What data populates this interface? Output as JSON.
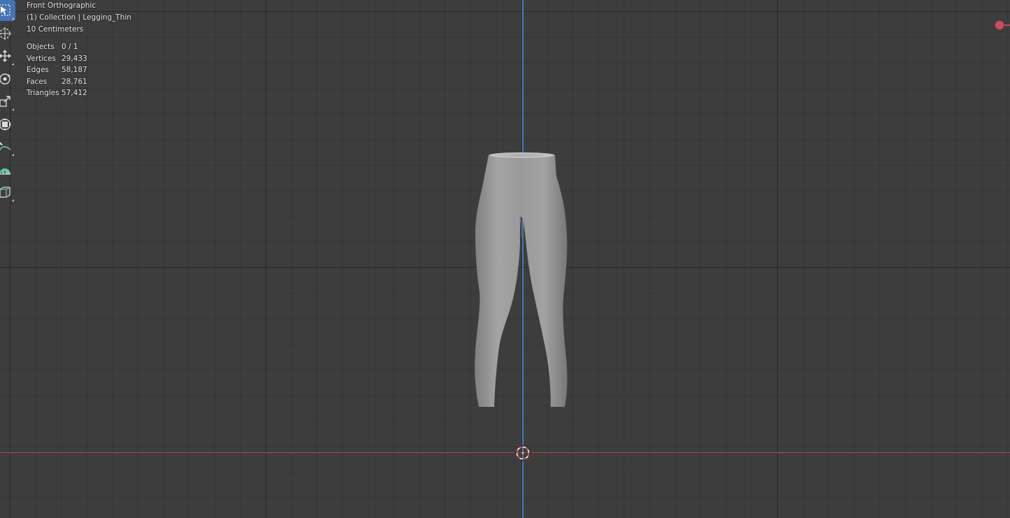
{
  "viewport": {
    "view_name": "Front Orthographic",
    "collection_line": "(1) Collection | Legging_Thin",
    "grid_scale": "10 Centimeters"
  },
  "stats": [
    {
      "label": "Objects",
      "value": "0 / 1"
    },
    {
      "label": "Vertices",
      "value": "29,433"
    },
    {
      "label": "Edges",
      "value": "58,187"
    },
    {
      "label": "Faces",
      "value": "28,761"
    },
    {
      "label": "Triangles",
      "value": "57,412"
    }
  ],
  "toolbar": [
    {
      "name": "select-box",
      "icon": "select-box-icon",
      "active": true
    },
    {
      "name": "cursor",
      "icon": "cursor-icon"
    },
    {
      "name": "move",
      "icon": "move-icon"
    },
    {
      "name": "rotate",
      "icon": "rotate-icon"
    },
    {
      "name": "scale",
      "icon": "scale-icon"
    },
    {
      "name": "transform",
      "icon": "transform-icon"
    },
    {
      "name": "annotate",
      "icon": "annotate-icon"
    },
    {
      "name": "measure",
      "icon": "measure-icon"
    },
    {
      "name": "add-cube",
      "icon": "add-cube-icon"
    }
  ],
  "colors": {
    "background": "#3d3d3d",
    "grid_line": "#2e2e2e",
    "axis_x": "#b04452",
    "axis_z": "#4a7cc0",
    "active_tool": "#4772b3",
    "mesh": "#9a9a9a"
  }
}
